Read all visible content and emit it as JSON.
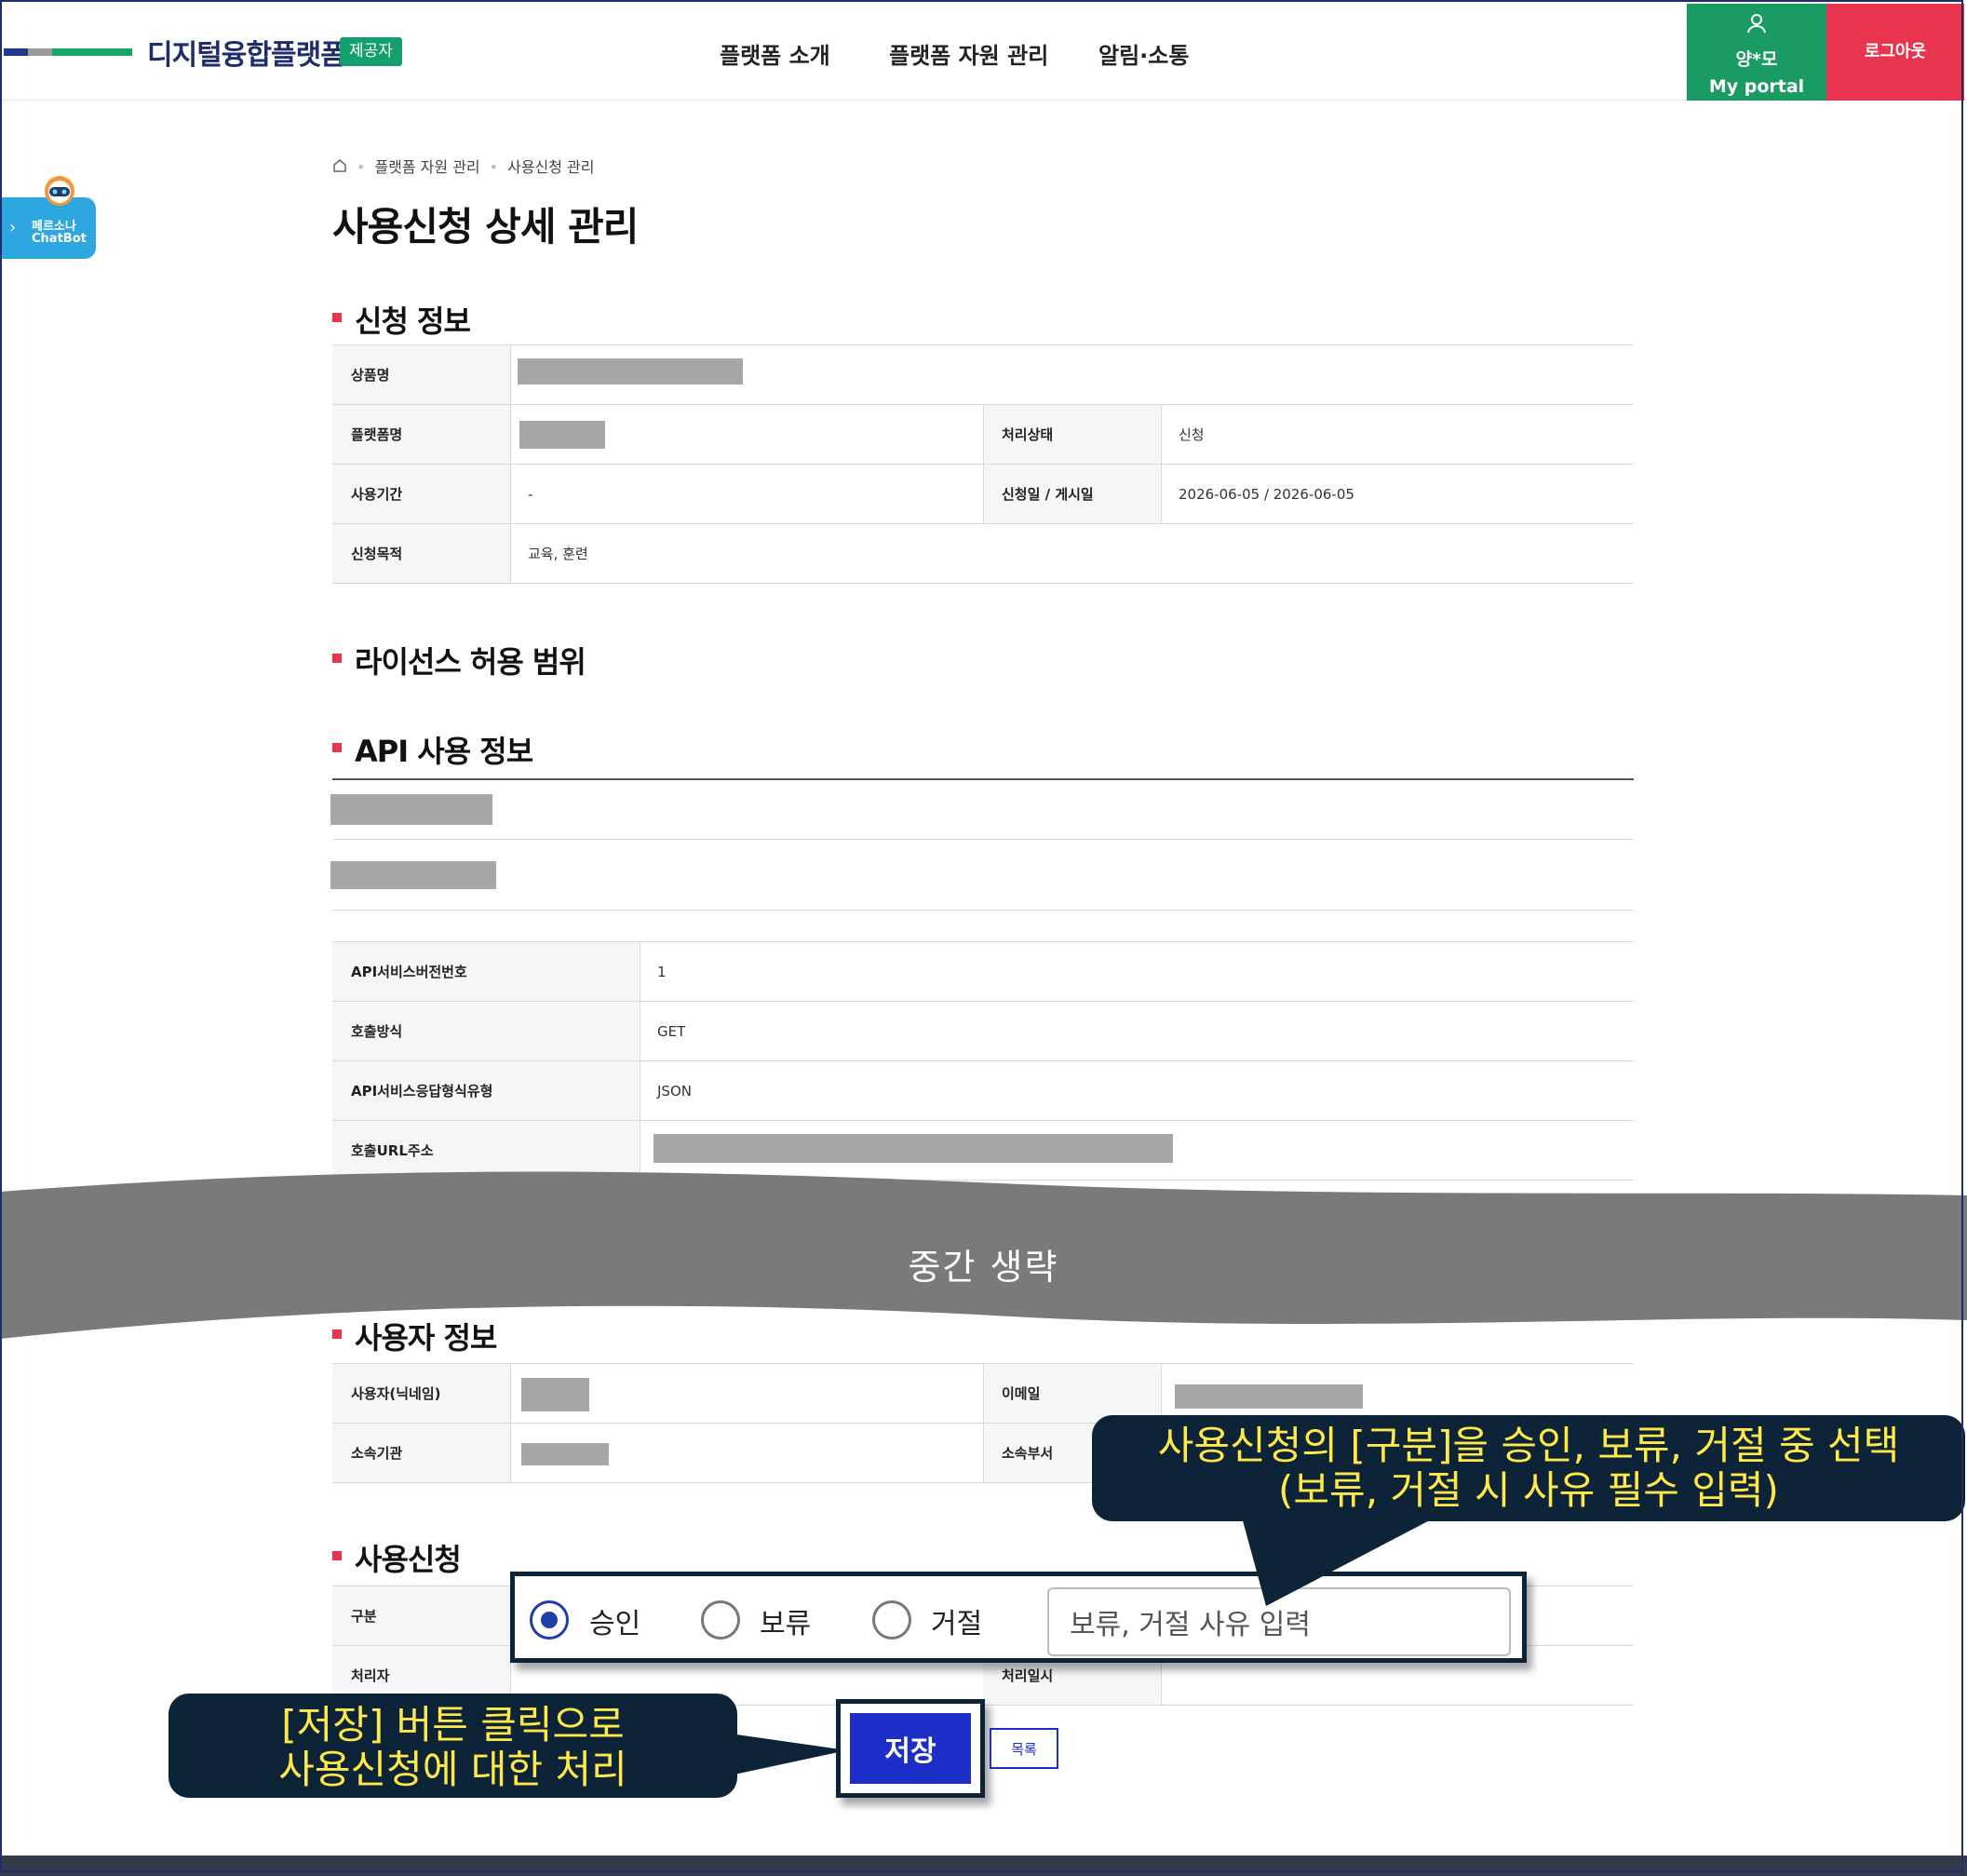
{
  "header": {
    "logo_text": "디지털융합플랫폼",
    "logo_badge": "제공자",
    "nav": [
      "플랫폼 소개",
      "플랫폼 자원 관리",
      "알림·소통"
    ],
    "user_name": "양*모",
    "portal_label": "My portal",
    "logout_label": "로그아웃"
  },
  "chatbot": {
    "line1": "페르소나",
    "line2": "ChatBot"
  },
  "breadcrumb": [
    "플랫폼 자원 관리",
    "사용신청 관리"
  ],
  "page_title": "사용신청 상세 관리",
  "sections": {
    "apply_info": "신청 정보",
    "license": "라이선스 허용 범위",
    "api_info": "API 사용 정보",
    "user_info": "사용자 정보",
    "usage_request": "사용신청"
  },
  "apply_info": {
    "product_label": "상품명",
    "platform_label": "플랫폼명",
    "status_label": "처리상태",
    "status_value": "신청",
    "period_label": "사용기간",
    "period_value": "-",
    "date_label": "신청일 / 게시일",
    "date_value": "2026-06-05 / 2026-06-05",
    "purpose_label": "신청목적",
    "purpose_value": "교육, 훈련"
  },
  "api_info": {
    "version_label": "API서비스버전번호",
    "version_value": "1",
    "method_label": "호출방식",
    "method_value": "GET",
    "format_label": "API서비스응답형식유형",
    "format_value": "JSON",
    "url_label": "호출URL주소"
  },
  "omission_text": "중간 생략",
  "user_info": {
    "nickname_label": "사용자(닉네임)",
    "email_label": "이메일",
    "org_label": "소속기관",
    "dept_label": "소속부서"
  },
  "usage_request": {
    "type_label": "구분",
    "handler_label": "처리자",
    "handled_at_label": "처리일시",
    "options": [
      "승인",
      "보류",
      "거절"
    ],
    "selected": "승인",
    "reason_placeholder": "보류, 거절 사유 입력",
    "save_label": "저장",
    "list_label": "목록"
  },
  "callouts": {
    "radio_line1": "사용신청의 [구분]을 승인, 보류, 거절 중 선택",
    "radio_line2": "(보류, 거절 시 사유 필수 입력)",
    "save_line1": "[저장] 버튼 클릭으로",
    "save_line2": "사용신청에 대한 처리"
  },
  "colors": {
    "brand_navy": "#1f2d6b",
    "brand_green": "#1a9b63",
    "logout_red": "#e8344e",
    "primary_button": "#1c2ec7",
    "callout_bg": "#0d2338",
    "callout_text": "#ffe94a"
  }
}
